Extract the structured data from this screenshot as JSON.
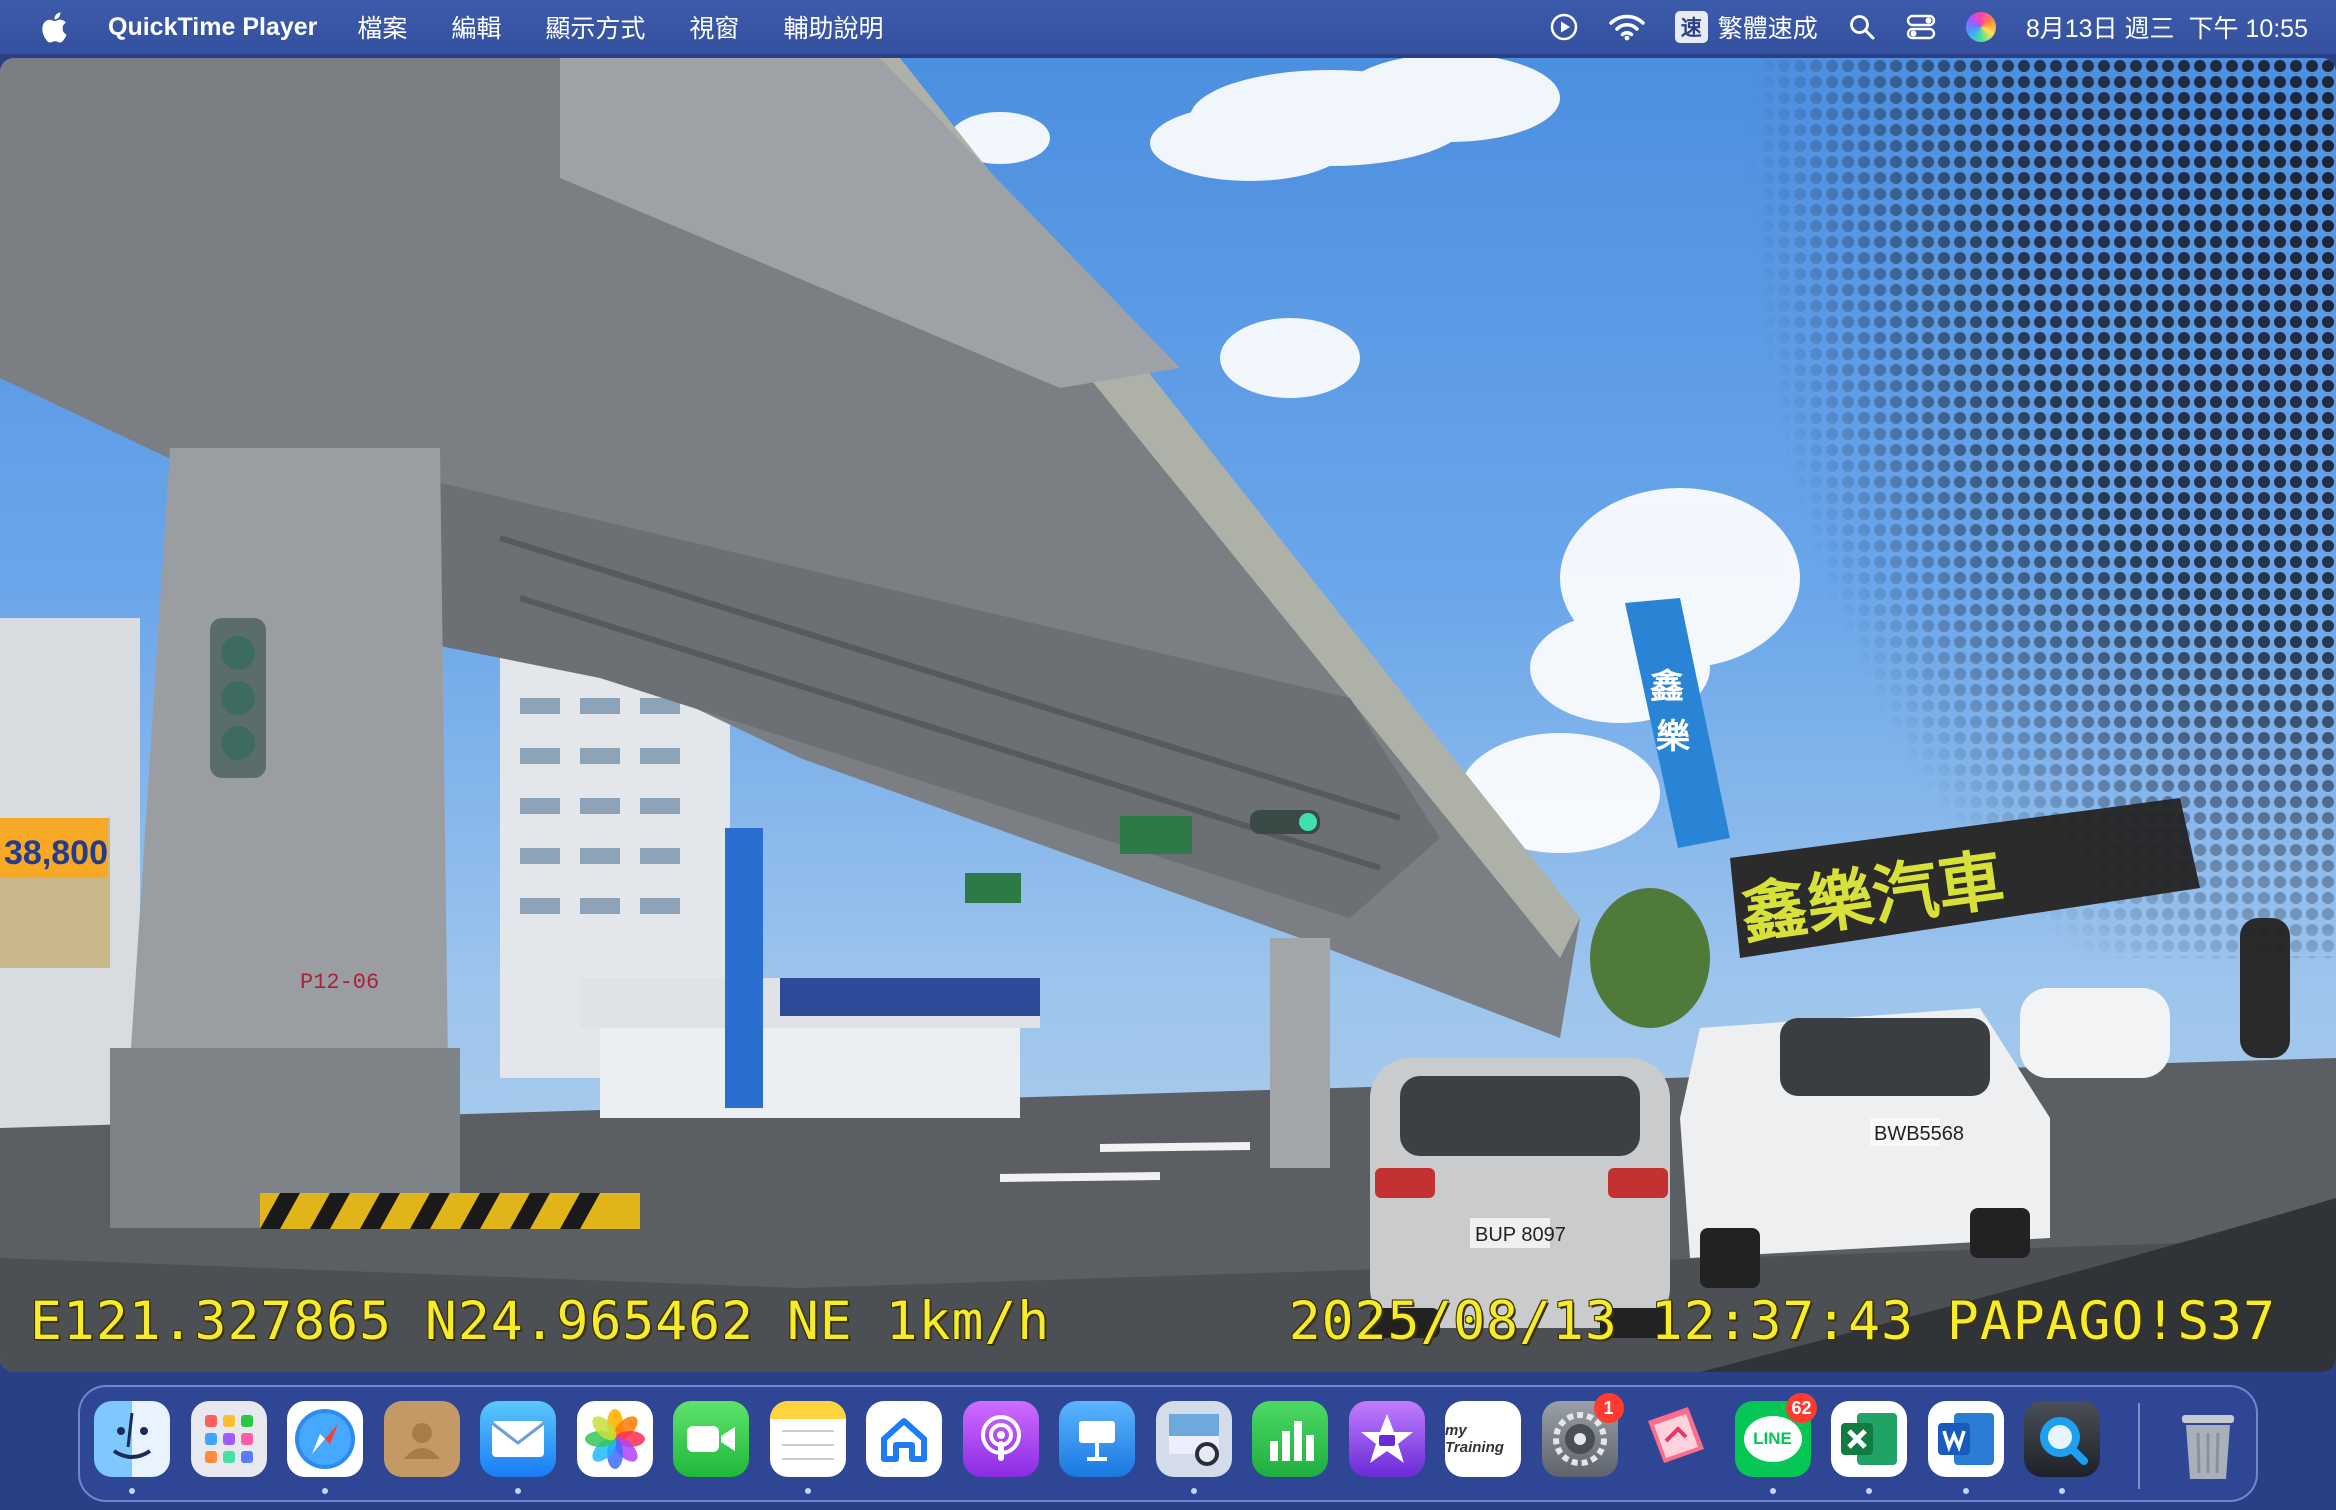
{
  "menubar": {
    "app_name": "QuickTime Player",
    "menus": [
      "檔案",
      "編輯",
      "顯示方式",
      "視窗",
      "輔助說明"
    ],
    "status": {
      "input_method_badge": "速",
      "input_method_label": "繁體速成",
      "date": "8月13日 週三",
      "time": "下午 10:55"
    }
  },
  "video": {
    "overlay_left": "E121.327865 N24.965462 NE 1km/h",
    "overlay_right": "2025/08/13 12:37:43 PAPAGO!S37"
  },
  "dock": {
    "items": [
      {
        "name": "finder",
        "running": true
      },
      {
        "name": "launchpad",
        "running": false
      },
      {
        "name": "safari",
        "running": true
      },
      {
        "name": "contacts",
        "running": false
      },
      {
        "name": "mail",
        "running": true
      },
      {
        "name": "photos",
        "running": false
      },
      {
        "name": "facetime",
        "running": false
      },
      {
        "name": "notes",
        "running": true
      },
      {
        "name": "home",
        "running": false
      },
      {
        "name": "podcasts",
        "running": false
      },
      {
        "name": "keynote",
        "running": false
      },
      {
        "name": "preview",
        "running": true
      },
      {
        "name": "numbers",
        "running": false
      },
      {
        "name": "imovie",
        "running": false
      },
      {
        "name": "my-training",
        "running": false,
        "label": "my Training"
      },
      {
        "name": "system-settings",
        "running": false,
        "badge": "1"
      },
      {
        "name": "pages-style-app",
        "running": false
      },
      {
        "name": "line",
        "running": true,
        "badge": "62",
        "label": "LINE"
      },
      {
        "name": "excel",
        "running": true
      },
      {
        "name": "word",
        "running": true
      },
      {
        "name": "quicktime-player",
        "running": true
      }
    ]
  }
}
